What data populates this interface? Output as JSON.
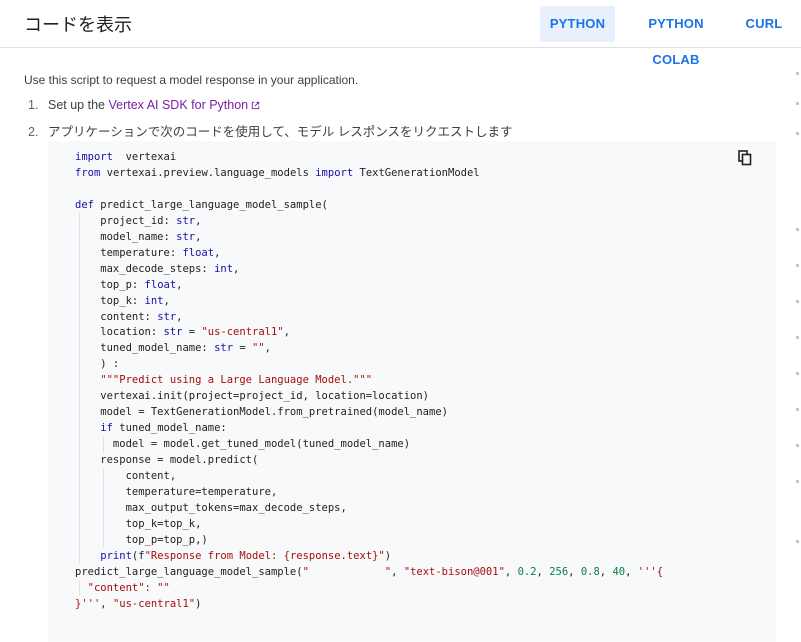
{
  "header": {
    "title": "コードを表示",
    "tabs": [
      {
        "label": "PYTHON",
        "active": true
      },
      {
        "label": "PYTHON COLAB",
        "active": false
      },
      {
        "label": "CURL",
        "active": false
      }
    ]
  },
  "intro": "Use this script to request a model response in your application.",
  "steps": [
    {
      "num": "1.",
      "text": "Set up the ",
      "link": "Vertex AI SDK for Python"
    },
    {
      "num": "2.",
      "text": "アプリケーションで次のコードを使用して、モデル レスポンスをリクエストします"
    }
  ],
  "code": {
    "lines": [
      [
        [
          "kw",
          "import"
        ],
        [
          "",
          "  vertexai"
        ]
      ],
      [
        [
          "kw",
          "from"
        ],
        [
          "",
          " vertexai.preview.language_models "
        ],
        [
          "kw",
          "import"
        ],
        [
          "",
          " TextGenerationModel"
        ]
      ],
      [],
      [
        [
          "kw",
          "def"
        ],
        [
          "",
          " predict_large_language_model_sample("
        ]
      ],
      [
        [
          "",
          "    project_id: "
        ],
        [
          "ty",
          "str"
        ],
        [
          "",
          ","
        ]
      ],
      [
        [
          "",
          "    model_name: "
        ],
        [
          "ty",
          "str"
        ],
        [
          "",
          ","
        ]
      ],
      [
        [
          "",
          "    temperature: "
        ],
        [
          "ty",
          "float"
        ],
        [
          "",
          ","
        ]
      ],
      [
        [
          "",
          "    max_decode_steps: "
        ],
        [
          "ty",
          "int"
        ],
        [
          "",
          ","
        ]
      ],
      [
        [
          "",
          "    top_p: "
        ],
        [
          "ty",
          "float"
        ],
        [
          "",
          ","
        ]
      ],
      [
        [
          "",
          "    top_k: "
        ],
        [
          "ty",
          "int"
        ],
        [
          "",
          ","
        ]
      ],
      [
        [
          "",
          "    content: "
        ],
        [
          "ty",
          "str"
        ],
        [
          "",
          ","
        ]
      ],
      [
        [
          "",
          "    location: "
        ],
        [
          "ty",
          "str"
        ],
        [
          "",
          " = "
        ],
        [
          "str",
          "\"us-central1\""
        ],
        [
          "",
          ","
        ]
      ],
      [
        [
          "",
          "    tuned_model_name: "
        ],
        [
          "ty",
          "str"
        ],
        [
          "",
          " = "
        ],
        [
          "str",
          "\"\""
        ],
        [
          "",
          ","
        ]
      ],
      [
        [
          "",
          "    ) :"
        ]
      ],
      [
        [
          "str",
          "    \"\"\"Predict using a Large Language Model.\"\"\""
        ]
      ],
      [
        [
          "",
          "    vertexai.init(project=project_id, location=location)"
        ]
      ],
      [
        [
          "",
          "    model = TextGenerationModel.from_pretrained(model_name)"
        ]
      ],
      [
        [
          "kw",
          "    if"
        ],
        [
          "",
          " tuned_model_name:"
        ]
      ],
      [
        [
          "",
          "      model = model.get_tuned_model(tuned_model_name)"
        ]
      ],
      [
        [
          "",
          "    response = model.predict("
        ]
      ],
      [
        [
          "",
          "        content,"
        ]
      ],
      [
        [
          "",
          "        temperature=temperature,"
        ]
      ],
      [
        [
          "",
          "        max_output_tokens=max_decode_steps,"
        ]
      ],
      [
        [
          "",
          "        top_k=top_k,"
        ]
      ],
      [
        [
          "",
          "        top_p=top_p,)"
        ]
      ],
      [
        [
          "kw",
          "    print"
        ],
        [
          "",
          "(f"
        ],
        [
          "str",
          "\"Response from Model: {response.text}\""
        ],
        [
          "",
          ")"
        ]
      ],
      [
        [
          "",
          "predict_large_language_model_sample("
        ],
        [
          "str",
          "\"            \""
        ],
        [
          "",
          ", "
        ],
        [
          "str",
          "\"text-bison@001\""
        ],
        [
          "",
          ", "
        ],
        [
          "num",
          "0.2"
        ],
        [
          "",
          ", "
        ],
        [
          "num",
          "256"
        ],
        [
          "",
          ", "
        ],
        [
          "num",
          "0.8"
        ],
        [
          "",
          ", "
        ],
        [
          "num",
          "40"
        ],
        [
          "",
          ", "
        ],
        [
          "str",
          "'''{"
        ]
      ],
      [
        [
          "str",
          "  \"content\": \"\""
        ]
      ],
      [
        [
          "str",
          "}'''"
        ],
        [
          "",
          ", "
        ],
        [
          "str",
          "\"us-central1\""
        ],
        [
          "",
          ")"
        ]
      ]
    ]
  },
  "icons": {
    "copy": "copy-icon",
    "external": "external-link-icon"
  }
}
